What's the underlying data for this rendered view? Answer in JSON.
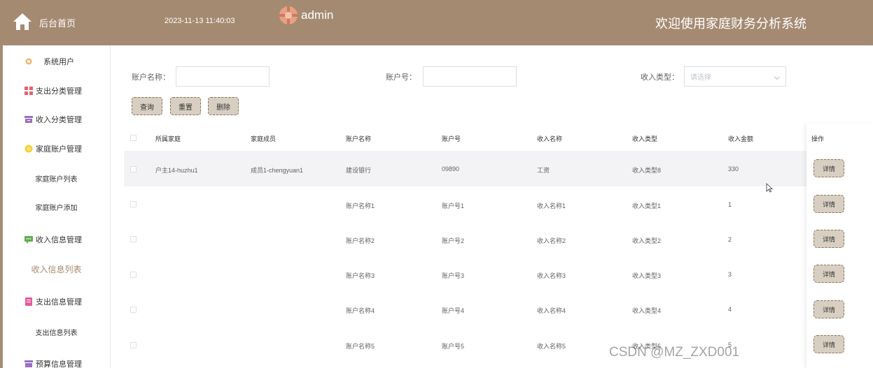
{
  "brand": {
    "title": "后台首页"
  },
  "header": {
    "datetime": "2023-11-13 11:40:03",
    "username": "admin",
    "system_title": "欢迎使用家庭财务分析系统"
  },
  "sidebar": {
    "items": [
      {
        "label": "系统用户",
        "icon": "gear-icon"
      },
      {
        "label": "支出分类管理",
        "icon": "grid-icon"
      },
      {
        "label": "收入分类管理",
        "icon": "archive-icon"
      },
      {
        "label": "家庭账户管理",
        "icon": "coin-icon"
      },
      {
        "label": "家庭账户列表",
        "icon": ""
      },
      {
        "label": "家庭账户添加",
        "icon": ""
      },
      {
        "label": "收入信息管理",
        "icon": "message-icon"
      },
      {
        "label": "收入信息列表",
        "icon": ""
      },
      {
        "label": "支出信息管理",
        "icon": "document-icon"
      },
      {
        "label": "支出信息列表",
        "icon": ""
      },
      {
        "label": "预算信息管理",
        "icon": "archive-icon"
      }
    ],
    "active": "收入信息列表"
  },
  "search": {
    "account_name_label": "账户名称：",
    "account_name_value": "",
    "account_no_label": "账户号：",
    "account_no_value": "",
    "income_type_label": "收入类型：",
    "income_type_placeholder": "请选择"
  },
  "buttons": {
    "query": "查询",
    "reset": "重置",
    "delete": "删除"
  },
  "table": {
    "columns": [
      "所属家庭",
      "家庭成员",
      "账户名称",
      "账户号",
      "收入名称",
      "收入类型",
      "收入金额",
      "操作"
    ],
    "rows": [
      [
        "户主14-huzhu1",
        "成员1-chengyuan1",
        "建设银行",
        "09890",
        "工资",
        "收入类型8",
        "330"
      ],
      [
        "",
        "",
        "账户名称1",
        "账户号1",
        "收入名称1",
        "收入类型1",
        "1"
      ],
      [
        "",
        "",
        "账户名称2",
        "账户号2",
        "收入名称2",
        "收入类型2",
        "2"
      ],
      [
        "",
        "",
        "账户名称3",
        "账户号3",
        "收入名称3",
        "收入类型3",
        "3"
      ],
      [
        "",
        "",
        "账户名称4",
        "账户号4",
        "收入名称4",
        "收入类型4",
        "4"
      ],
      [
        "",
        "",
        "账户名称5",
        "账户号5",
        "收入名称5",
        "收入类型5",
        "5"
      ]
    ],
    "detail_label": "详情"
  },
  "watermark": "CSDN @MZ_ZXD001",
  "colors": {
    "brand": "#a58a72",
    "button_bg": "#d8cfc2",
    "active_text": "#a58a72"
  }
}
